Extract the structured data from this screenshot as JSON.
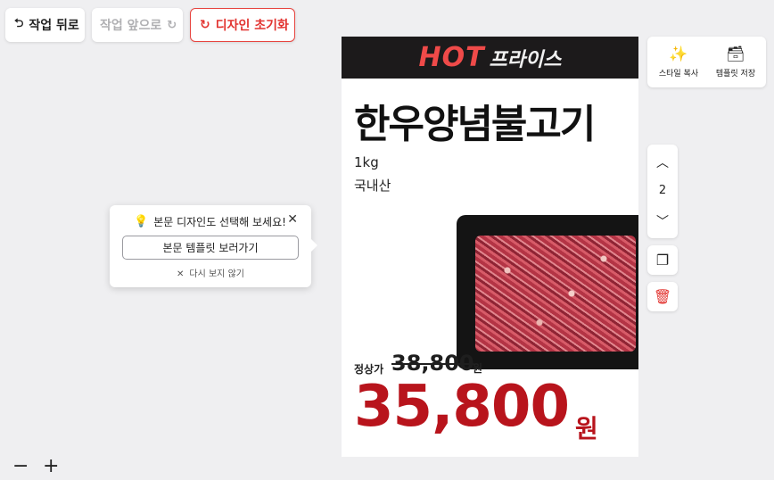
{
  "toolbar": {
    "undo_label": "작업 뒤로",
    "redo_label": "작업 앞으로",
    "reset_label": "디자인 초기화",
    "undo_icon": "undo-icon",
    "redo_icon": "redo-icon",
    "reset_icon": "refresh-icon",
    "reset_color": "#e2332f"
  },
  "popup": {
    "title": "본문 디자인도 선택해 보세요!",
    "button_label": "본문 템플릿 보러가기",
    "dismiss_label": "다시 보지 않기",
    "icon": "lightbulb-icon"
  },
  "card": {
    "banner_hot": "HOT",
    "banner_price": "프라이스",
    "product_name": "한우양념불고기",
    "weight": "1kg",
    "origin": "국내산",
    "regular_label": "정상가",
    "regular_price": "38,800",
    "regular_unit": "원",
    "sale_price": "35,800",
    "sale_unit": "원",
    "accent_color": "#b8141c",
    "banner_color": "#ef4a49"
  },
  "side_tools": {
    "copy_style_label": "스타일 복사",
    "save_template_label": "템플릿 저장",
    "copy_style_icon": "magic-wand-icon",
    "save_template_icon": "archive-icon"
  },
  "order": {
    "page_number": "2"
  },
  "zoom": {
    "out_icon": "minus-icon",
    "in_icon": "plus-icon"
  }
}
